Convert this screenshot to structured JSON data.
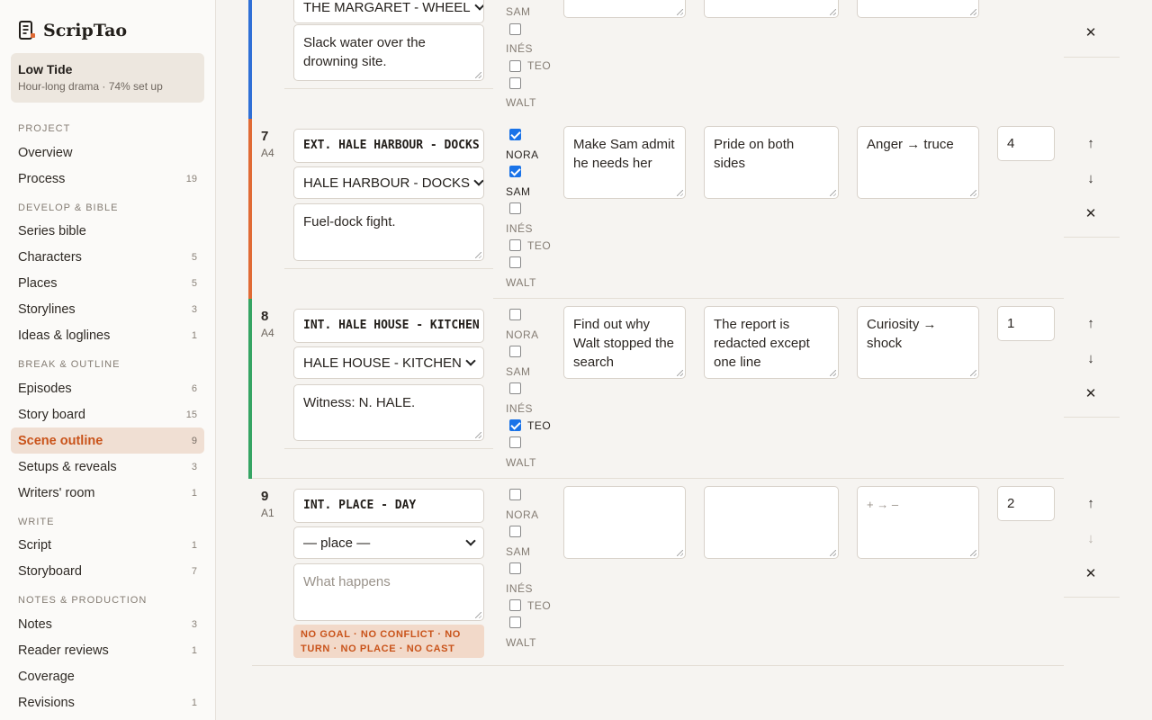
{
  "app": {
    "name": "ScripTao"
  },
  "project": {
    "title": "Low Tide",
    "subtitle": "Hour-long drama · 74% set up",
    "setup_progress": 0.74
  },
  "sections": {
    "project": "PROJECT",
    "develop": "DEVELOP & BIBLE",
    "break": "BREAK & OUTLINE",
    "write": "WRITE",
    "notes": "NOTES & PRODUCTION"
  },
  "nav": {
    "overview": {
      "label": "Overview",
      "count": ""
    },
    "process": {
      "label": "Process",
      "count": "19"
    },
    "series_bible": {
      "label": "Series bible",
      "count": ""
    },
    "characters": {
      "label": "Characters",
      "count": "5"
    },
    "places": {
      "label": "Places",
      "count": "5"
    },
    "storylines": {
      "label": "Storylines",
      "count": "3"
    },
    "ideas": {
      "label": "Ideas & loglines",
      "count": "1"
    },
    "episodes": {
      "label": "Episodes",
      "count": "6"
    },
    "story_board": {
      "label": "Story board",
      "count": "15"
    },
    "scene_outline": {
      "label": "Scene outline",
      "count": "9"
    },
    "setups": {
      "label": "Setups & reveals",
      "count": "3"
    },
    "writers_room": {
      "label": "Writers' room",
      "count": "1"
    },
    "script": {
      "label": "Script",
      "count": "1"
    },
    "storyboard": {
      "label": "Storyboard",
      "count": "7"
    },
    "notes": {
      "label": "Notes",
      "count": "3"
    },
    "reader_reviews": {
      "label": "Reader reviews",
      "count": "1"
    },
    "coverage": {
      "label": "Coverage",
      "count": ""
    },
    "revisions": {
      "label": "Revisions",
      "count": "1"
    }
  },
  "cast_names": {
    "nora": "NORA",
    "sam": "SAM",
    "ines": "INÉS",
    "teo": "TEO",
    "walt": "WALT"
  },
  "scenes": [
    {
      "place": "THE MARGARET - WHEEL",
      "summary": "Slack water over the drowning site.",
      "accent": "#2f6fd6",
      "cast": {
        "sam": false,
        "ines": false,
        "teo": false,
        "walt": false
      }
    },
    {
      "number": "7",
      "act": "A4",
      "slug": "EXT. HALE HARBOUR - DOCKS - NIGHT",
      "place": "HALE HARBOUR - DOCKS",
      "summary": "Fuel-dock fight.",
      "goal": "Make Sam admit he needs her",
      "conflict": "Pride on both sides",
      "turn": "Anger → truce",
      "tension": "4",
      "accent": "#e06a35",
      "cast": {
        "nora": true,
        "sam": true,
        "ines": false,
        "teo": false,
        "walt": false
      }
    },
    {
      "number": "8",
      "act": "A4",
      "slug": "INT. HALE HOUSE - KITCHEN - DAY",
      "place": "HALE HOUSE - KITCHEN",
      "summary": "Witness: N. HALE.",
      "goal": "Find out why Walt stopped the search",
      "conflict": "The report is redacted except one line",
      "turn": "Curiosity → shock",
      "tension": "1",
      "accent": "#35a463",
      "cast": {
        "nora": false,
        "sam": false,
        "ines": false,
        "teo": true,
        "walt": false
      }
    },
    {
      "number": "9",
      "act": "A1",
      "slug": "INT. PLACE - DAY",
      "place": "— place —",
      "summary_placeholder": "What happens",
      "goal": "",
      "conflict": "",
      "turn_placeholder": "+ → –",
      "tension": "2",
      "warning": "NO GOAL · NO CONFLICT · NO TURN · NO PLACE · NO CAST",
      "cast": {
        "nora": false,
        "sam": false,
        "ines": false,
        "teo": false,
        "walt": false
      }
    }
  ],
  "actions": {
    "up": "↑",
    "down": "↓",
    "remove": "✕"
  }
}
